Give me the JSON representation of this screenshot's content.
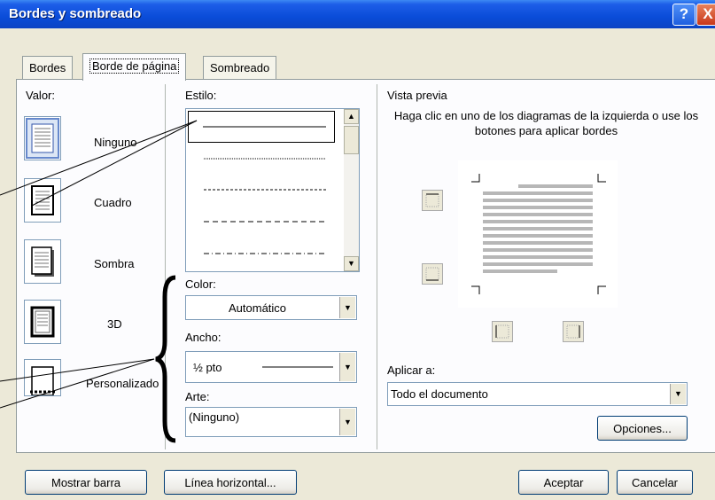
{
  "window": {
    "title": "Bordes y sombreado",
    "help_label": "?",
    "close_label": "X"
  },
  "tabs": [
    {
      "label": "Bordes"
    },
    {
      "label": "Borde de página"
    },
    {
      "label": "Sombreado"
    }
  ],
  "setting": {
    "label": "Valor:",
    "options": [
      {
        "label": "Ninguno",
        "icon": "border-none-icon"
      },
      {
        "label": "Cuadro",
        "icon": "border-box-icon"
      },
      {
        "label": "Sombra",
        "icon": "border-shadow-icon"
      },
      {
        "label": "3D",
        "icon": "border-3d-icon"
      },
      {
        "label": "Personalizado",
        "icon": "border-custom-icon"
      }
    ]
  },
  "style": {
    "label": "Estilo:",
    "items": [
      "solid",
      "dotted",
      "dashed-small",
      "dashed-large",
      "dash-dot"
    ]
  },
  "color": {
    "label": "Color:",
    "value": "Automático"
  },
  "width": {
    "label": "Ancho:",
    "value": "½ pto"
  },
  "art": {
    "label": "Arte:",
    "value": "(Ninguno)"
  },
  "preview": {
    "label": "Vista previa",
    "hint": "Haga clic en uno de los diagramas de la izquierda o use los botones para aplicar bordes"
  },
  "apply_to": {
    "label": "Aplicar a:",
    "value": "Todo el documento"
  },
  "buttons": {
    "options": "Opciones...",
    "show_toolbar": "Mostrar barra",
    "horizontal_line": "Línea horizontal...",
    "ok": "Aceptar",
    "cancel": "Cancelar"
  }
}
